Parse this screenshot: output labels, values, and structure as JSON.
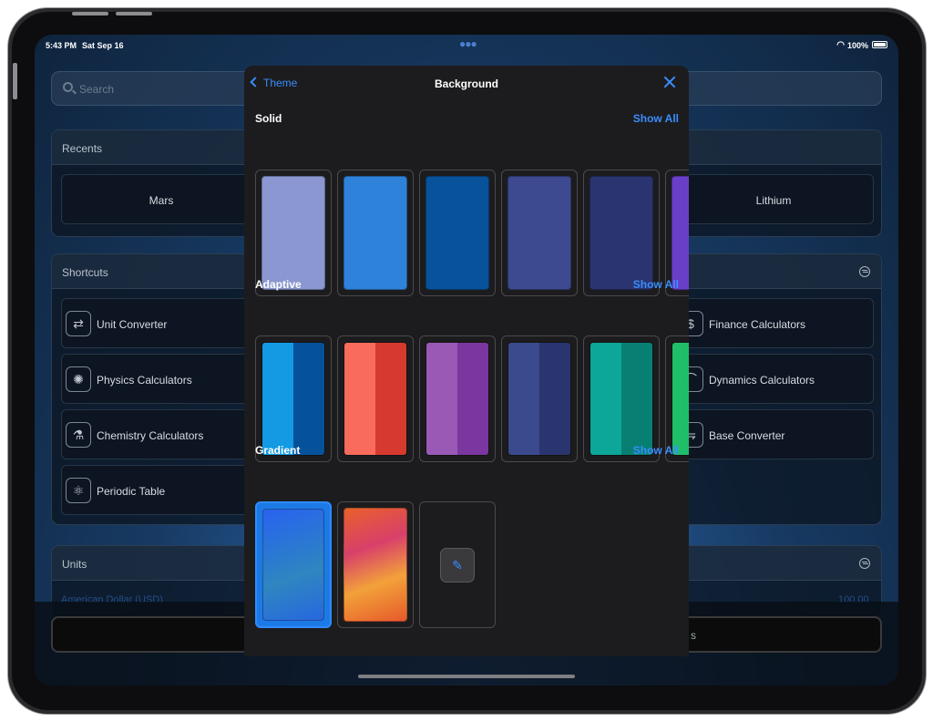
{
  "status": {
    "time": "5:43 PM",
    "date": "Sat Sep 16",
    "battery": "100%"
  },
  "search": {
    "placeholder": "Search"
  },
  "recents": {
    "title": "Recents",
    "items": [
      "Mars",
      "Lithium"
    ]
  },
  "shortcuts": {
    "title": "Shortcuts",
    "left": [
      {
        "label": "Unit Converter",
        "icon": "unit-converter-icon"
      },
      {
        "label": "Physics Calculators",
        "icon": "lightbulb-icon"
      },
      {
        "label": "Chemistry Calculators",
        "icon": "flask-icon"
      },
      {
        "label": "Periodic Table",
        "icon": "atom-icon"
      }
    ],
    "right": [
      {
        "label": "Finance Calculators",
        "icon": "finance-icon"
      },
      {
        "label": "Dynamics Calculators",
        "icon": "dynamics-icon"
      },
      {
        "label": "Base Converter",
        "icon": "base-converter-icon"
      }
    ]
  },
  "units": {
    "title": "Units",
    "row_label": "American Dollar (USD)",
    "row_value": "100.00"
  },
  "bottom_bar": {
    "text": "s"
  },
  "modal": {
    "back_label": "Theme",
    "title": "Background",
    "sections": {
      "solid": {
        "title": "Solid",
        "show_all": "Show All",
        "colors": [
          "#8a97d0",
          "#2f82da",
          "#07529a",
          "#3d4a90",
          "#2a3470",
          "#6a3fc7"
        ]
      },
      "adaptive": {
        "title": "Adaptive",
        "show_all": "Show All",
        "pairs": [
          [
            "#139ae3",
            "#06529a"
          ],
          [
            "#f96b5c",
            "#d63a2f"
          ],
          [
            "#9b59b6",
            "#7b36a0"
          ],
          [
            "#3b4a8c",
            "#2a3570"
          ],
          [
            "#0ca798",
            "#078073"
          ],
          [
            "#1fbf6a",
            "#12a055"
          ]
        ]
      },
      "gradient": {
        "title": "Gradient",
        "show_all": "Show All",
        "items": [
          "blue-gradient",
          "sunset-gradient"
        ]
      }
    }
  }
}
